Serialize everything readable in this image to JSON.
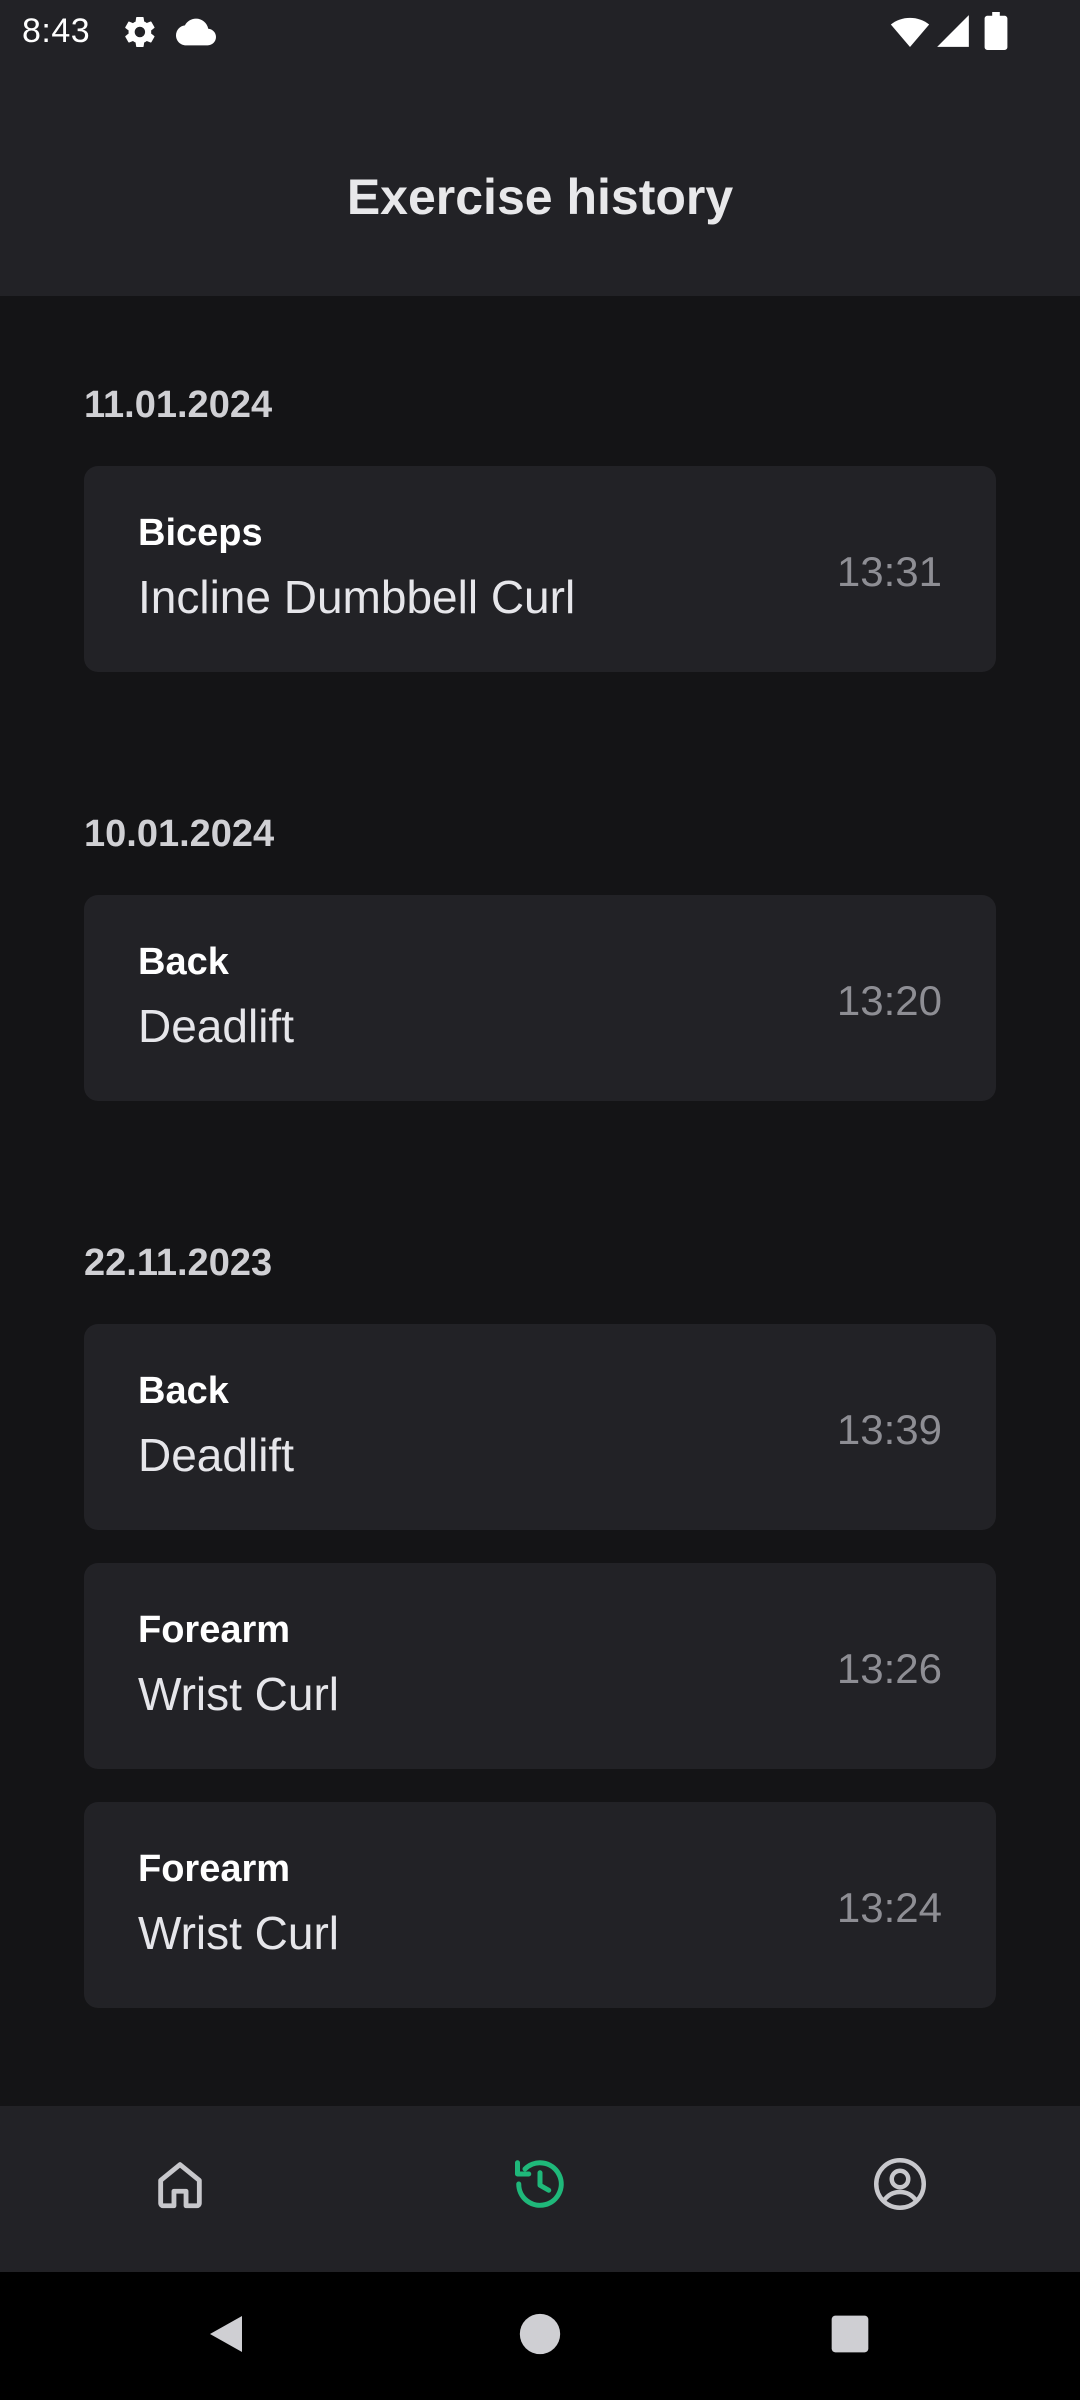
{
  "status_bar": {
    "time": "8:43",
    "icons": [
      "gear-icon",
      "cloud-icon",
      "wifi-icon",
      "signal-icon",
      "battery-icon"
    ]
  },
  "app_bar": {
    "title": "Exercise history"
  },
  "history": {
    "groups": [
      {
        "date": "11.01.2024",
        "entries": [
          {
            "category": "Biceps",
            "exercise": "Incline Dumbbell Curl",
            "time": "13:31"
          }
        ]
      },
      {
        "date": "10.01.2024",
        "entries": [
          {
            "category": "Back",
            "exercise": "Deadlift",
            "time": "13:20"
          }
        ]
      },
      {
        "date": "22.11.2023",
        "entries": [
          {
            "category": "Back",
            "exercise": "Deadlift",
            "time": "13:39"
          },
          {
            "category": "Forearm",
            "exercise": "Wrist Curl",
            "time": "13:26"
          },
          {
            "category": "Forearm",
            "exercise": "Wrist Curl",
            "time": "13:24"
          }
        ]
      }
    ]
  },
  "bottom_nav": {
    "items": [
      {
        "icon": "home-icon",
        "active": false
      },
      {
        "icon": "history-icon",
        "active": true
      },
      {
        "icon": "account-icon",
        "active": false
      }
    ],
    "active_color": "#1fb87a",
    "inactive_color": "#c8c8cc"
  },
  "system_nav": {
    "buttons": [
      "back-icon",
      "home-circle-icon",
      "recents-icon"
    ]
  }
}
